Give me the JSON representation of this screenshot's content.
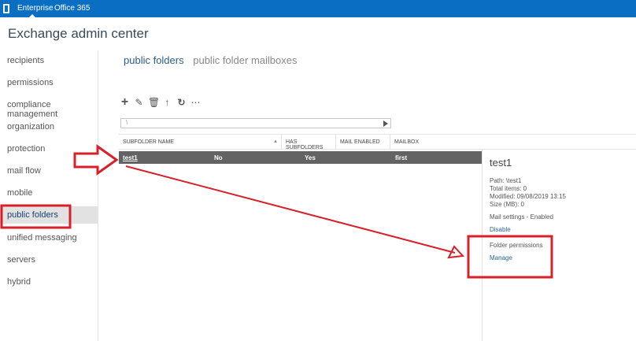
{
  "topbar": {
    "enterprise": "Enterprise",
    "office365": "Office 365"
  },
  "title": "Exchange admin center",
  "sidebar": {
    "items": [
      "recipients",
      "permissions",
      "compliance management",
      "organization",
      "protection",
      "mail flow",
      "mobile",
      "public folders",
      "unified messaging",
      "servers",
      "hybrid"
    ],
    "selected": "public folders"
  },
  "tabs": {
    "active": "public folders",
    "other": "public folder mailboxes"
  },
  "toolbar": {
    "icons": [
      "add-icon",
      "edit-icon",
      "delete-icon",
      "up-icon",
      "refresh-icon",
      "more-icon"
    ]
  },
  "path": {
    "value": "\\"
  },
  "table": {
    "headers": [
      "SUBFOLDER NAME",
      "HAS SUBFOLDERS",
      "MAIL ENABLED",
      "MAILBOX"
    ],
    "rows": [
      {
        "name": "test1",
        "has_subfolders": "No",
        "mail_enabled": "Yes",
        "mailbox": "first"
      }
    ]
  },
  "details": {
    "title": "test1",
    "path": "Path: \\test1",
    "total_items": "Total items: 0",
    "modified": "Modified: 09/08/2019 13:15",
    "size": "Size (MB): 0",
    "mail_settings": "Mail settings - Enabled",
    "disable": "Disable",
    "folder_permissions": "Folder permissions",
    "manage": "Manage"
  },
  "colors": {
    "topbar": "#0a6fc2",
    "annotation": "#d9202a"
  }
}
